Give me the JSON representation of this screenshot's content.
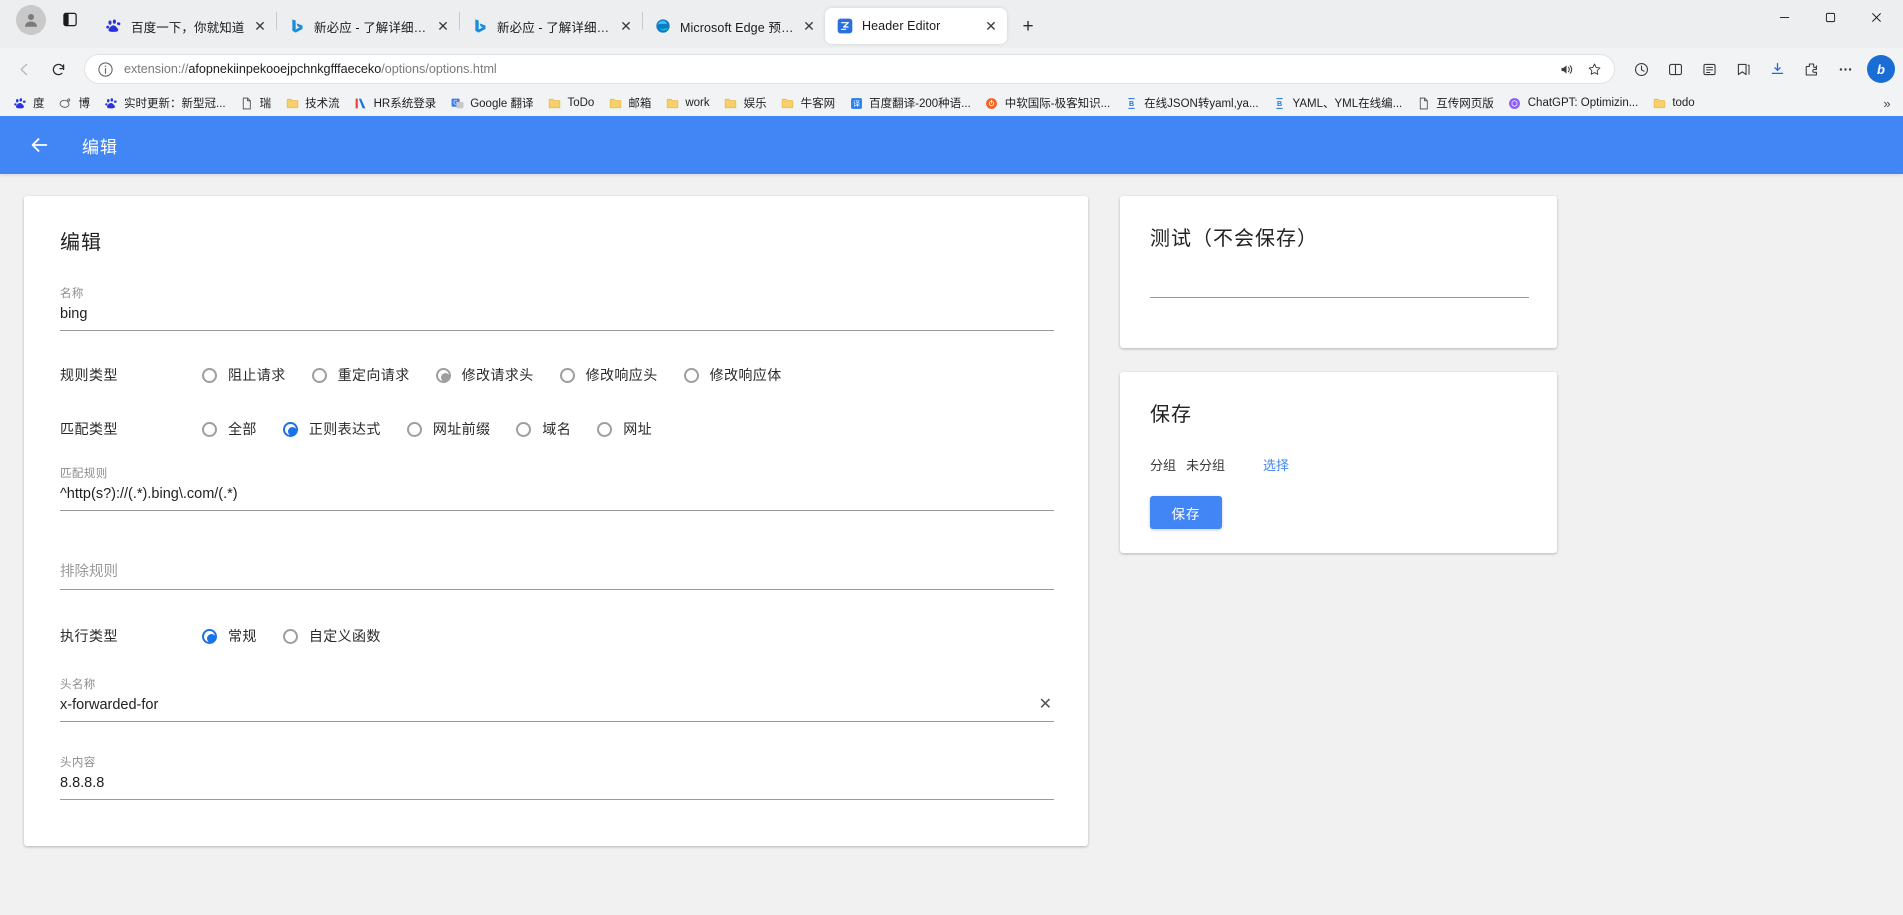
{
  "browser": {
    "profile_icon": "person-icon",
    "tab_list_icon": "tab-list-icon",
    "tabs": [
      {
        "title": "百度一下，你就知道",
        "favicon": "baidu-icon",
        "active": false
      },
      {
        "title": "新必应 - 了解详细信息",
        "favicon": "bing-icon",
        "active": false
      },
      {
        "title": "新必应 - 了解详细信息",
        "favicon": "bing-icon",
        "active": false
      },
      {
        "title": "Microsoft Edge 预览体验成员",
        "favicon": "edge-icon",
        "active": false
      },
      {
        "title": "Header Editor",
        "favicon": "header-editor-icon",
        "active": true
      }
    ],
    "new_tab_label": "+",
    "window_controls": {
      "minimize": "–",
      "maximize": "□",
      "close": "✕"
    },
    "nav": {
      "back_label": "←",
      "reload_label": "⟳",
      "url_prefix": "extension://",
      "url_host": "afopnekiinpekooejpchnkgfffaeceko",
      "url_path": "/options/options.html",
      "url_full": "extension://afopnekiinpekooejpchnkgfffaeceko/options/options.html",
      "read_aloud_icon": "read-aloud-icon",
      "favorite_icon": "star-icon",
      "right_buttons": [
        "history-icon",
        "split-screen-icon",
        "collections-icon",
        "favorites-icon",
        "downloads-icon",
        "extensions-icon",
        "settings-more-icon"
      ],
      "bing_badge": "b"
    },
    "bookmarks": [
      {
        "label": "度",
        "icon": "baidu-icon"
      },
      {
        "label": "博",
        "icon": "weibo-icon"
      },
      {
        "label": "实时更新：新型冠...",
        "icon": "baidu-icon"
      },
      {
        "label": "瑞",
        "icon": "doc-icon"
      },
      {
        "label": "技术流",
        "icon": "folder-icon"
      },
      {
        "label": "HR系统登录",
        "icon": "hr-icon"
      },
      {
        "label": "Google 翻译",
        "icon": "google-translate-icon"
      },
      {
        "label": "ToDo",
        "icon": "folder-icon"
      },
      {
        "label": "邮箱",
        "icon": "folder-icon"
      },
      {
        "label": "work",
        "icon": "folder-icon"
      },
      {
        "label": "娱乐",
        "icon": "folder-icon"
      },
      {
        "label": "牛客网",
        "icon": "folder-icon"
      },
      {
        "label": "百度翻译-200种语...",
        "icon": "baidu-fanyi-icon"
      },
      {
        "label": "中软国际-极客知识...",
        "icon": "chinasoft-icon"
      },
      {
        "label": "在线JSON转yaml,ya...",
        "icon": "bejson-icon"
      },
      {
        "label": "YAML、YML在线编...",
        "icon": "bejson-icon"
      },
      {
        "label": "互传网页版",
        "icon": "doc-icon"
      },
      {
        "label": "ChatGPT: Optimizin...",
        "icon": "chatgpt-icon"
      },
      {
        "label": "todo",
        "icon": "folder-icon"
      }
    ],
    "bookmarks_overflow": "»"
  },
  "app": {
    "header_title": "编辑",
    "back_icon": "arrow-left-icon",
    "accent_color": "#4285f4",
    "edit_card": {
      "title": "编辑",
      "name_field": {
        "label": "名称",
        "value": "bing"
      },
      "rule_type": {
        "label": "规则类型",
        "options": [
          {
            "label": "阻止请求",
            "selected": false
          },
          {
            "label": "重定向请求",
            "selected": false
          },
          {
            "label": "修改请求头",
            "selected": true
          },
          {
            "label": "修改响应头",
            "selected": false
          },
          {
            "label": "修改响应体",
            "selected": false
          }
        ],
        "selected_style": "gray"
      },
      "match_type": {
        "label": "匹配类型",
        "options": [
          {
            "label": "全部",
            "selected": false
          },
          {
            "label": "正则表达式",
            "selected": true
          },
          {
            "label": "网址前缀",
            "selected": false
          },
          {
            "label": "域名",
            "selected": false
          },
          {
            "label": "网址",
            "selected": false
          }
        ],
        "selected_style": "blue"
      },
      "match_rule": {
        "label": "匹配规则",
        "value": "^http(s?)://(.*).bing\\.com/(.*)"
      },
      "exclude_rule": {
        "label": "",
        "placeholder": "排除规则",
        "value": ""
      },
      "exec_type": {
        "label": "执行类型",
        "options": [
          {
            "label": "常规",
            "selected": true
          },
          {
            "label": "自定义函数",
            "selected": false
          }
        ],
        "selected_style": "blue"
      },
      "header_name": {
        "label": "头名称",
        "value": "x-forwarded-for",
        "clear_icon": "close-icon"
      },
      "header_content": {
        "label": "头内容",
        "value": "8.8.8.8"
      }
    },
    "test_card": {
      "title": "测试（不会保存）",
      "input_value": ""
    },
    "save_card": {
      "title": "保存",
      "group_label": "分组",
      "group_value": "未分组",
      "choose_label": "选择",
      "save_button": "保存"
    }
  }
}
